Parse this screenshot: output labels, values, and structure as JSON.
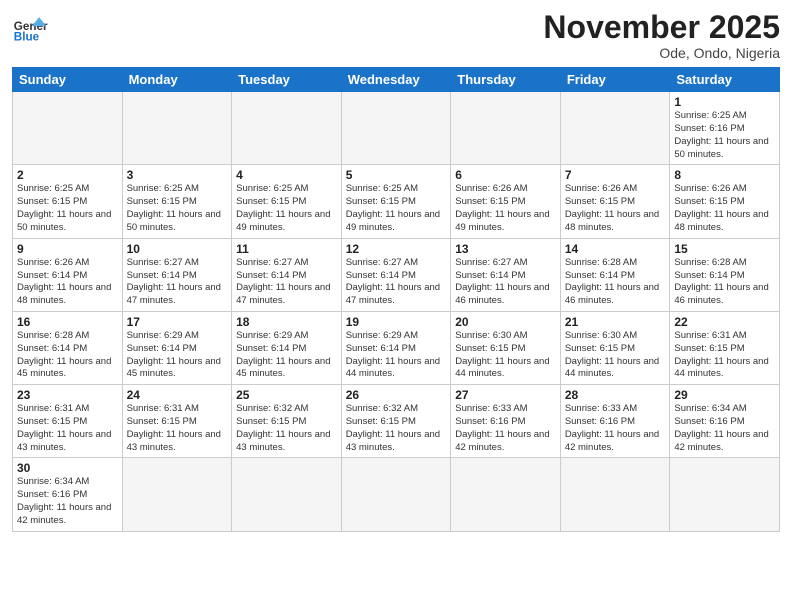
{
  "logo": {
    "general": "General",
    "blue": "Blue"
  },
  "title": "November 2025",
  "location": "Ode, Ondo, Nigeria",
  "days_of_week": [
    "Sunday",
    "Monday",
    "Tuesday",
    "Wednesday",
    "Thursday",
    "Friday",
    "Saturday"
  ],
  "weeks": [
    [
      {
        "day": "",
        "info": ""
      },
      {
        "day": "",
        "info": ""
      },
      {
        "day": "",
        "info": ""
      },
      {
        "day": "",
        "info": ""
      },
      {
        "day": "",
        "info": ""
      },
      {
        "day": "",
        "info": ""
      },
      {
        "day": "1",
        "info": "Sunrise: 6:25 AM\nSunset: 6:16 PM\nDaylight: 11 hours\nand 50 minutes."
      }
    ],
    [
      {
        "day": "2",
        "info": "Sunrise: 6:25 AM\nSunset: 6:15 PM\nDaylight: 11 hours\nand 50 minutes."
      },
      {
        "day": "3",
        "info": "Sunrise: 6:25 AM\nSunset: 6:15 PM\nDaylight: 11 hours\nand 50 minutes."
      },
      {
        "day": "4",
        "info": "Sunrise: 6:25 AM\nSunset: 6:15 PM\nDaylight: 11 hours\nand 49 minutes."
      },
      {
        "day": "5",
        "info": "Sunrise: 6:25 AM\nSunset: 6:15 PM\nDaylight: 11 hours\nand 49 minutes."
      },
      {
        "day": "6",
        "info": "Sunrise: 6:26 AM\nSunset: 6:15 PM\nDaylight: 11 hours\nand 49 minutes."
      },
      {
        "day": "7",
        "info": "Sunrise: 6:26 AM\nSunset: 6:15 PM\nDaylight: 11 hours\nand 48 minutes."
      },
      {
        "day": "8",
        "info": "Sunrise: 6:26 AM\nSunset: 6:15 PM\nDaylight: 11 hours\nand 48 minutes."
      }
    ],
    [
      {
        "day": "9",
        "info": "Sunrise: 6:26 AM\nSunset: 6:14 PM\nDaylight: 11 hours\nand 48 minutes."
      },
      {
        "day": "10",
        "info": "Sunrise: 6:27 AM\nSunset: 6:14 PM\nDaylight: 11 hours\nand 47 minutes."
      },
      {
        "day": "11",
        "info": "Sunrise: 6:27 AM\nSunset: 6:14 PM\nDaylight: 11 hours\nand 47 minutes."
      },
      {
        "day": "12",
        "info": "Sunrise: 6:27 AM\nSunset: 6:14 PM\nDaylight: 11 hours\nand 47 minutes."
      },
      {
        "day": "13",
        "info": "Sunrise: 6:27 AM\nSunset: 6:14 PM\nDaylight: 11 hours\nand 46 minutes."
      },
      {
        "day": "14",
        "info": "Sunrise: 6:28 AM\nSunset: 6:14 PM\nDaylight: 11 hours\nand 46 minutes."
      },
      {
        "day": "15",
        "info": "Sunrise: 6:28 AM\nSunset: 6:14 PM\nDaylight: 11 hours\nand 46 minutes."
      }
    ],
    [
      {
        "day": "16",
        "info": "Sunrise: 6:28 AM\nSunset: 6:14 PM\nDaylight: 11 hours\nand 45 minutes."
      },
      {
        "day": "17",
        "info": "Sunrise: 6:29 AM\nSunset: 6:14 PM\nDaylight: 11 hours\nand 45 minutes."
      },
      {
        "day": "18",
        "info": "Sunrise: 6:29 AM\nSunset: 6:14 PM\nDaylight: 11 hours\nand 45 minutes."
      },
      {
        "day": "19",
        "info": "Sunrise: 6:29 AM\nSunset: 6:14 PM\nDaylight: 11 hours\nand 44 minutes."
      },
      {
        "day": "20",
        "info": "Sunrise: 6:30 AM\nSunset: 6:15 PM\nDaylight: 11 hours\nand 44 minutes."
      },
      {
        "day": "21",
        "info": "Sunrise: 6:30 AM\nSunset: 6:15 PM\nDaylight: 11 hours\nand 44 minutes."
      },
      {
        "day": "22",
        "info": "Sunrise: 6:31 AM\nSunset: 6:15 PM\nDaylight: 11 hours\nand 44 minutes."
      }
    ],
    [
      {
        "day": "23",
        "info": "Sunrise: 6:31 AM\nSunset: 6:15 PM\nDaylight: 11 hours\nand 43 minutes."
      },
      {
        "day": "24",
        "info": "Sunrise: 6:31 AM\nSunset: 6:15 PM\nDaylight: 11 hours\nand 43 minutes."
      },
      {
        "day": "25",
        "info": "Sunrise: 6:32 AM\nSunset: 6:15 PM\nDaylight: 11 hours\nand 43 minutes."
      },
      {
        "day": "26",
        "info": "Sunrise: 6:32 AM\nSunset: 6:15 PM\nDaylight: 11 hours\nand 43 minutes."
      },
      {
        "day": "27",
        "info": "Sunrise: 6:33 AM\nSunset: 6:16 PM\nDaylight: 11 hours\nand 42 minutes."
      },
      {
        "day": "28",
        "info": "Sunrise: 6:33 AM\nSunset: 6:16 PM\nDaylight: 11 hours\nand 42 minutes."
      },
      {
        "day": "29",
        "info": "Sunrise: 6:34 AM\nSunset: 6:16 PM\nDaylight: 11 hours\nand 42 minutes."
      }
    ],
    [
      {
        "day": "30",
        "info": "Sunrise: 6:34 AM\nSunset: 6:16 PM\nDaylight: 11 hours\nand 42 minutes."
      },
      {
        "day": "",
        "info": ""
      },
      {
        "day": "",
        "info": ""
      },
      {
        "day": "",
        "info": ""
      },
      {
        "day": "",
        "info": ""
      },
      {
        "day": "",
        "info": ""
      },
      {
        "day": "",
        "info": ""
      }
    ]
  ]
}
